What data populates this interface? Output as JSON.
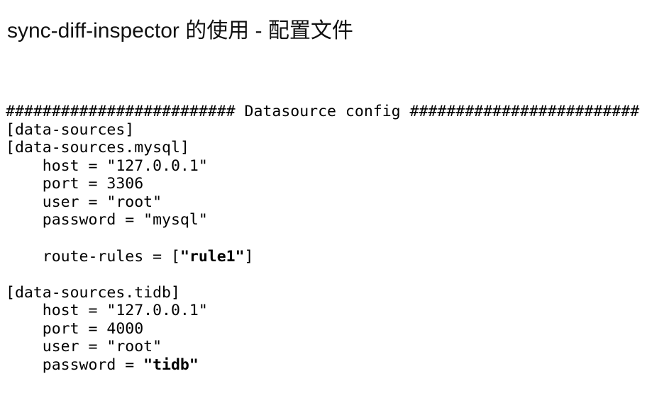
{
  "slide": {
    "title": "sync-diff-inspector 的使用 - 配置文件"
  },
  "code": {
    "banner": "######################### Datasource config #########################",
    "data_sources_table": "[data-sources]",
    "mysql": {
      "header": "[data-sources.mysql]",
      "host": "host = \"127.0.0.1\"",
      "port": "port = 3306",
      "user": "user = \"root\"",
      "password": "password = \"mysql\"",
      "route_rules_key": "route-rules = [",
      "route_rules_value": "\"rule1\"",
      "route_rules_close": "]"
    },
    "tidb": {
      "header": "[data-sources.tidb]",
      "host": "host = \"127.0.0.1\"",
      "port": "port = 4000",
      "user": "user = \"root\"",
      "password_key": "password = ",
      "password_value": "\"tidb\""
    }
  }
}
